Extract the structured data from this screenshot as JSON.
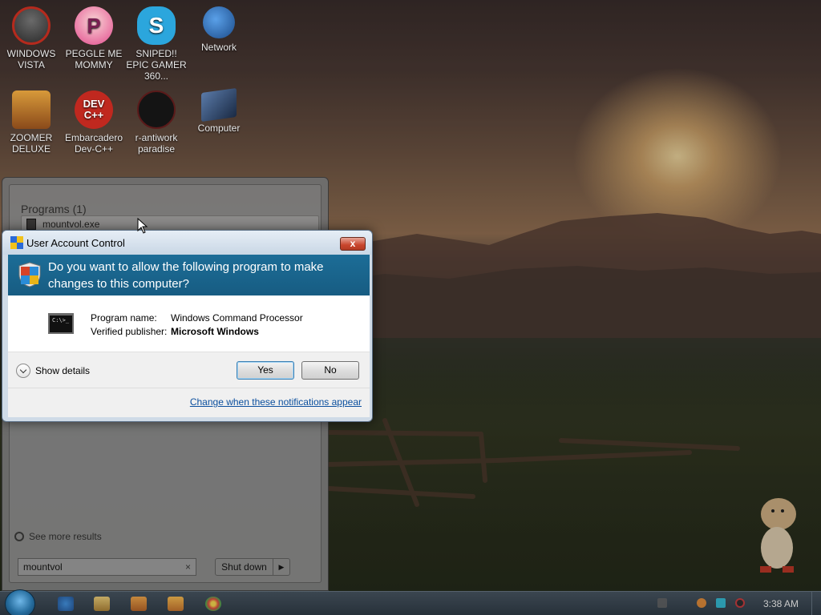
{
  "desktop": {
    "icons": [
      {
        "name": "windows-vista",
        "label": "WINDOWS VISTA",
        "icon": "vista-orb-icon",
        "color": "#c0392b"
      },
      {
        "name": "peggle",
        "label": "PEGGLE ME MOMMY",
        "icon": "peggle-p-icon",
        "color": "#e24a8d"
      },
      {
        "name": "sniped",
        "label": "SNIPED!! EPIC GAMER 360...",
        "icon": "skype-s-icon",
        "color": "#2ba6dd"
      },
      {
        "name": "network",
        "label": "Network",
        "icon": "network-globe-icon",
        "color": "#2a5ea8"
      },
      {
        "name": "zoomer",
        "label": "ZOOMER DELUXE",
        "icon": "zoomer-icon",
        "color": "#c07a2a"
      },
      {
        "name": "devcpp",
        "label": "Embarcadero Dev-C++",
        "icon": "devcpp-icon",
        "color": "#c0281f"
      },
      {
        "name": "antiwork",
        "label": "r-antiwork paradise",
        "icon": "antiwork-icon",
        "color": "#1a1a1a"
      },
      {
        "name": "computer",
        "label": "Computer",
        "icon": "computer-monitor-icon",
        "color": "#3a4e6e"
      }
    ]
  },
  "start_menu": {
    "programs_header": "Programs (1)",
    "program_item": "mountvol.exe",
    "see_more": "See more results",
    "search_value": "mountvol",
    "clear_glyph": "×",
    "shutdown_label": "Shut down",
    "shutdown_arrow": "▶"
  },
  "uac": {
    "title": "User Account Control",
    "close_glyph": "x",
    "question": "Do you want to allow the following program to make changes to this computer?",
    "cmd_icon_text": "C:\\>_",
    "program_name_label": "Program name:",
    "program_name_value": "Windows Command Processor",
    "publisher_label": "Verified publisher:",
    "publisher_value": "Microsoft Windows",
    "show_details": "Show details",
    "yes_label": "Yes",
    "no_label": "No",
    "change_link": "Change when these notifications appear"
  },
  "taskbar": {
    "clock": "3:38 AM"
  }
}
